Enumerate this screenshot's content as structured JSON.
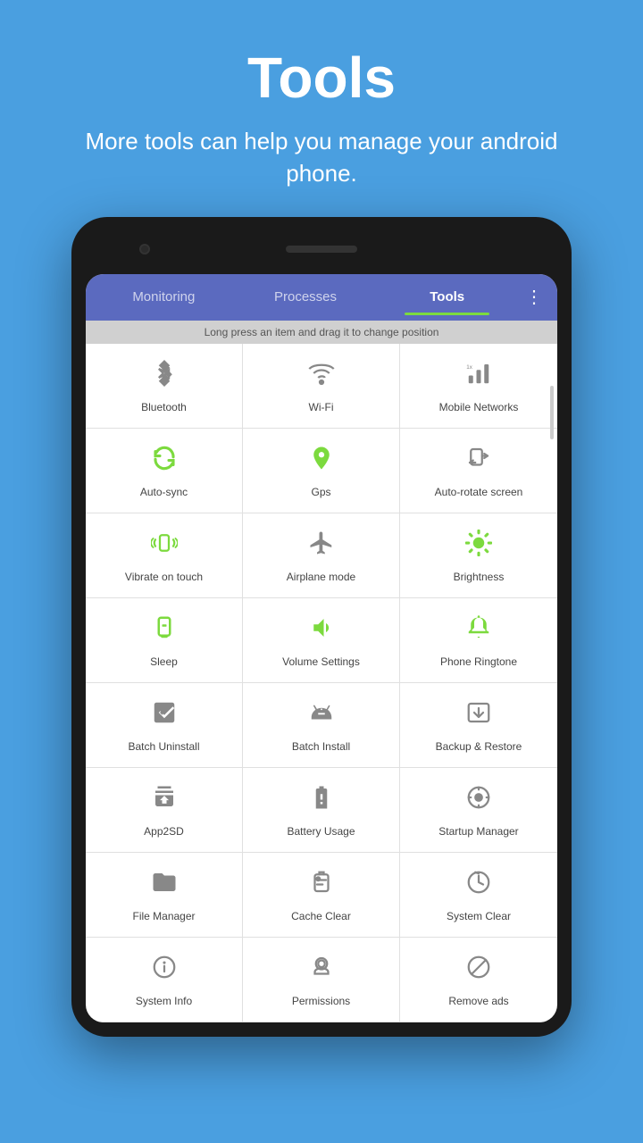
{
  "header": {
    "title": "Tools",
    "subtitle": "More tools can help you manage your android phone."
  },
  "nav": {
    "tabs": [
      {
        "label": "Monitoring",
        "active": false
      },
      {
        "label": "Processes",
        "active": false
      },
      {
        "label": "Tools",
        "active": true
      }
    ],
    "more_icon": "⋮"
  },
  "hint": {
    "text": "Long press an item and drag it to change position"
  },
  "tools": [
    {
      "id": "bluetooth",
      "label": "Bluetooth",
      "icon": "bluetooth",
      "color": "gray"
    },
    {
      "id": "wifi",
      "label": "Wi-Fi",
      "icon": "wifi",
      "color": "gray"
    },
    {
      "id": "mobile-networks",
      "label": "Mobile Networks",
      "icon": "mobile-networks",
      "color": "gray"
    },
    {
      "id": "auto-sync",
      "label": "Auto-sync",
      "icon": "auto-sync",
      "color": "green"
    },
    {
      "id": "gps",
      "label": "Gps",
      "icon": "gps",
      "color": "green"
    },
    {
      "id": "auto-rotate",
      "label": "Auto-rotate screen",
      "icon": "auto-rotate",
      "color": "gray"
    },
    {
      "id": "vibrate",
      "label": "Vibrate on touch",
      "icon": "vibrate",
      "color": "green"
    },
    {
      "id": "airplane",
      "label": "Airplane mode",
      "icon": "airplane",
      "color": "gray"
    },
    {
      "id": "brightness",
      "label": "Brightness",
      "icon": "brightness",
      "color": "green"
    },
    {
      "id": "sleep",
      "label": "Sleep",
      "icon": "sleep",
      "color": "green"
    },
    {
      "id": "volume",
      "label": "Volume Settings",
      "icon": "volume",
      "color": "green"
    },
    {
      "id": "ringtone",
      "label": "Phone Ringtone",
      "icon": "ringtone",
      "color": "green"
    },
    {
      "id": "batch-uninstall",
      "label": "Batch Uninstall",
      "icon": "batch-uninstall",
      "color": "gray"
    },
    {
      "id": "batch-install",
      "label": "Batch Install",
      "icon": "batch-install",
      "color": "gray"
    },
    {
      "id": "backup",
      "label": "Backup & Restore",
      "icon": "backup",
      "color": "gray"
    },
    {
      "id": "app2sd",
      "label": "App2SD",
      "icon": "app2sd",
      "color": "gray"
    },
    {
      "id": "battery",
      "label": "Battery Usage",
      "icon": "battery",
      "color": "gray"
    },
    {
      "id": "startup",
      "label": "Startup Manager",
      "icon": "startup",
      "color": "gray"
    },
    {
      "id": "file-manager",
      "label": "File Manager",
      "icon": "file-manager",
      "color": "gray"
    },
    {
      "id": "cache-clear",
      "label": "Cache Clear",
      "icon": "cache-clear",
      "color": "gray"
    },
    {
      "id": "system-clear",
      "label": "System Clear",
      "icon": "system-clear",
      "color": "gray"
    },
    {
      "id": "system-info",
      "label": "System Info",
      "icon": "system-info",
      "color": "gray"
    },
    {
      "id": "permissions",
      "label": "Permissions",
      "icon": "permissions",
      "color": "gray"
    },
    {
      "id": "remove-ads",
      "label": "Remove ads",
      "icon": "remove-ads",
      "color": "gray"
    }
  ]
}
